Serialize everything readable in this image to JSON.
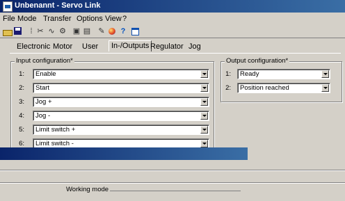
{
  "window": {
    "title": "Unbenannt - Servo Link"
  },
  "menu": [
    "File",
    "Mode",
    "Transfer",
    "Options",
    "View",
    "?"
  ],
  "toolbar": [
    "open-icon",
    "save-icon",
    "tool-icon",
    "wrench-icon",
    "compare-icon",
    "monitor-icon",
    "monitor2-icon",
    "edit-icon",
    "globe-icon",
    "help-icon",
    "window-icon"
  ],
  "tabs": [
    "Electronic",
    "Motor",
    "User",
    "In-/Outputs",
    "Regulator",
    "Jog"
  ],
  "active_tab": "In-/Outputs",
  "input_config": {
    "title": "Input configuration*",
    "rows": [
      {
        "num": "1:",
        "value": "Enable"
      },
      {
        "num": "2:",
        "value": "Start"
      },
      {
        "num": "3:",
        "value": "Jog +"
      },
      {
        "num": "4:",
        "value": "Jog -"
      },
      {
        "num": "5:",
        "value": "Limit switch +"
      },
      {
        "num": "6:",
        "value": "Limit switch -"
      }
    ]
  },
  "output_config": {
    "title": "Output configuration*",
    "rows": [
      {
        "num": "1:",
        "value": "Ready"
      },
      {
        "num": "2:",
        "value": "Position reached"
      }
    ]
  },
  "overlay": {
    "working_mode_label": "Working mode"
  }
}
